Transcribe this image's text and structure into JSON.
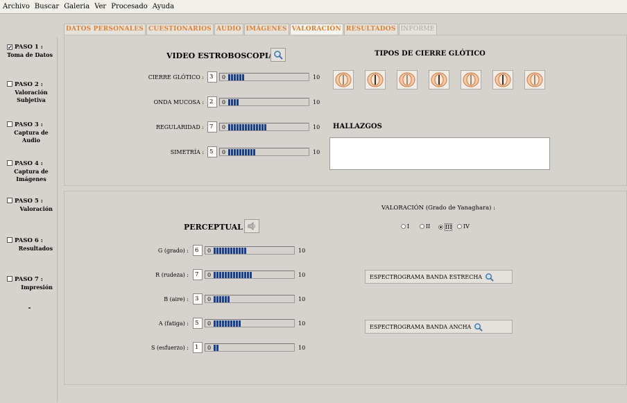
{
  "menu": [
    "Archivo",
    "Buscar",
    "Galeria",
    "Ver",
    "Procesado",
    "Ayuda"
  ],
  "tabs": [
    {
      "label": "DATOS PERSONALES",
      "state": "normal"
    },
    {
      "label": "CUESTIONARIOS",
      "state": "normal"
    },
    {
      "label": "AUDIO",
      "state": "normal"
    },
    {
      "label": "IMÁGENES",
      "state": "normal"
    },
    {
      "label": "VALORACIÓN",
      "state": "active"
    },
    {
      "label": "RESULTADOS",
      "state": "normal"
    },
    {
      "label": "INFORME",
      "state": "disabled"
    }
  ],
  "steps": [
    {
      "title": "PASO 1 :",
      "sub": "Toma de Datos",
      "checked": true
    },
    {
      "title": "PASO 2 :",
      "sub": "Valoración Subjetiva",
      "checked": false
    },
    {
      "title": "PASO 3 :",
      "sub": "Captura de Audio",
      "checked": false
    },
    {
      "title": "PASO 4 :",
      "sub": "Captura de Imágenes",
      "checked": false
    },
    {
      "title": "PASO 5 :",
      "sub": "Valoración",
      "checked": false
    },
    {
      "title": "PASO 6 :",
      "sub": "Resultados",
      "checked": false
    },
    {
      "title": "PASO 7 :",
      "sub": "Impresión",
      "checked": false
    }
  ],
  "video": {
    "title": "VIDEO ESTROBOSCOPIA",
    "min": "0",
    "max": "10",
    "rows": [
      {
        "label": "CIERRE GLÓTICO :",
        "value": "3"
      },
      {
        "label": "ONDA MUCOSA :",
        "value": "2"
      },
      {
        "label": "REGULARIDAD :",
        "value": "7"
      },
      {
        "label": "SIMETRÍA :",
        "value": "5"
      }
    ]
  },
  "closure": {
    "title": "TIPOS DE CIERRE GLÓTICO",
    "icon": "glottis-icon",
    "count": 7
  },
  "hallazgos": {
    "title": "HALLAZGOS",
    "text": ""
  },
  "perceptual": {
    "title": "PERCEPTUAL",
    "icon": "speaker-icon",
    "min": "0",
    "max": "10",
    "rows": [
      {
        "label": "G (grado) :",
        "value": "6"
      },
      {
        "label": "R (rudeza) :",
        "value": "7"
      },
      {
        "label": "B (aire) :",
        "value": "3"
      },
      {
        "label": "A (fatiga) :",
        "value": "5"
      },
      {
        "label": "S (esfuerzo) :",
        "value": "1"
      }
    ]
  },
  "yanaghara": {
    "title": "VALORACIÓN (Grado de Yanaghara) :",
    "options": [
      "I",
      "II",
      "III",
      "IV"
    ],
    "selected": "III"
  },
  "buttons": {
    "narrow": "ESPECTROGRAMA BANDA ESTRECHA",
    "wide": "ESPECTROGRAMA BANDA ANCHA",
    "icon": "search-icon"
  },
  "colors": {
    "accent": "#e08030",
    "bar": "#1a3f8e",
    "background": "#d6d3ce"
  }
}
